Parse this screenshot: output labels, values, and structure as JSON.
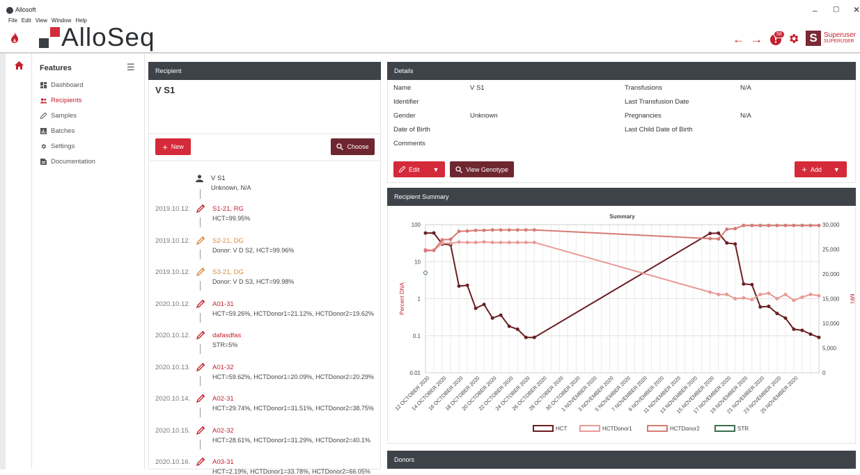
{
  "window": {
    "app_name": "Allosoft",
    "menu": [
      "File",
      "Edit",
      "View",
      "Window",
      "Help"
    ],
    "logo_text": "AlloSeq",
    "minimize": "–",
    "maximize": "▢",
    "close": "✕"
  },
  "header": {
    "back": "←",
    "forward": "→",
    "notification_count": "58",
    "user_initial": "S",
    "user_name": "Superuser",
    "user_role": "SUPERUSER"
  },
  "sidebar": {
    "title": "Features",
    "items": [
      {
        "label": "Dashboard"
      },
      {
        "label": "Recipients"
      },
      {
        "label": "Samples"
      },
      {
        "label": "Batches"
      },
      {
        "label": "Settings"
      },
      {
        "label": "Documentation"
      }
    ]
  },
  "recipient": {
    "header": "Recipient",
    "name": "V S1",
    "new_label": "New",
    "choose_label": "Choose",
    "timeline_head": {
      "name": "V S1",
      "sub": "Unknown, N/A"
    },
    "timeline": [
      {
        "date": "2019.10.12.",
        "title": "S1-21, RG",
        "sub": "HCT=99.95%",
        "color": "#c4202f"
      },
      {
        "date": "2019.10.12.",
        "title": "S2-21, DG",
        "sub": "Donor: V D S2, HCT=99.96%",
        "color": "#d98a3a"
      },
      {
        "date": "2019.10.12.",
        "title": "S3-21, DG",
        "sub": "Donor: V D S3, HCT=99.98%",
        "color": "#d98a3a"
      },
      {
        "date": "2020.10.12.",
        "title": "A01-31",
        "sub": "HCT=59.26%, HCTDonor1=21.12%, HCTDonor2=19.62%",
        "color": "#c4202f"
      },
      {
        "date": "2020.10.12.",
        "title": "dafasdfas",
        "sub": "STR=5%",
        "color": "#c4202f"
      },
      {
        "date": "2020.10.13.",
        "title": "A01-32",
        "sub": "HCT=59.62%, HCTDonor1=20.09%, HCTDonor2=20.29%",
        "color": "#c4202f"
      },
      {
        "date": "2020.10.14.",
        "title": "A02-31",
        "sub": "HCT=29.74%, HCTDonor1=31.51%, HCTDonor2=38.75%",
        "color": "#c4202f"
      },
      {
        "date": "2020.10.15.",
        "title": "A02-32",
        "sub": "HCT=28.61%, HCTDonor1=31.29%, HCTDonor2=40.1%",
        "color": "#c4202f"
      },
      {
        "date": "2020.10.16.",
        "title": "A03-31",
        "sub": "HCT=2.19%, HCTDonor1=33.78%, HCTDonor2=66.05%",
        "color": "#c4202f"
      }
    ]
  },
  "details": {
    "header": "Details",
    "name_label": "Name",
    "name_value": "V S1",
    "identifier_label": "Identifier",
    "gender_label": "Gender",
    "gender_value": "Unknown",
    "dob_label": "Date of Birth",
    "comments_label": "Comments",
    "transfusions_label": "Transfusions",
    "transfusions_value": "N/A",
    "last_transfusion_label": "Last Transfusion Date",
    "pregnancies_label": "Pregnancies",
    "pregnancies_value": "N/A",
    "last_child_label": "Last Child Date of Birth",
    "edit_label": "Edit",
    "view_genotype_label": "View Genotype",
    "add_label": "Add"
  },
  "summary": {
    "header": "Recipient Summary"
  },
  "donors": {
    "header": "Donors"
  },
  "chart_data": {
    "type": "line",
    "title": "Summary",
    "ylabel": "Percent DNA",
    "y2label": "MFI",
    "y_scale": "log",
    "ylim": [
      0.01,
      100
    ],
    "y2lim": [
      0,
      30000
    ],
    "y_ticks": [
      "100",
      "10",
      "1",
      "0.1",
      "0.01"
    ],
    "y2_ticks": [
      "30,000",
      "25,000",
      "20,000",
      "15,000",
      "10,000",
      "5,000",
      "0"
    ],
    "x_ticks": [
      "12 OCTOBER 2020",
      "14 OCTOBER 2020",
      "16 OCTOBER 2020",
      "18 OCTOBER 2020",
      "20 OCTOBER 2020",
      "22 OCTOBER 2020",
      "24 OCTOBER 2020",
      "26 OCTOBER 2020",
      "28 OCTOBER 2020",
      "30 OCTOBER 2020",
      "1 NOVEMBER 2020",
      "3 NOVEMBER 2020",
      "5 NOVEMBER 2020",
      "7 NOVEMBER 2020",
      "9 NOVEMBER 2020",
      "11 NOVEMBER 2020",
      "13 NOVEMBER 2020",
      "15 NOVEMBER 2020",
      "17 NOVEMBER 2020",
      "19 NOVEMBER 2020",
      "21 NOVEMBER 2020",
      "23 NOVEMBER 2020",
      "25 NOVEMBER 2020"
    ],
    "legend_position": "bottom",
    "series": [
      {
        "name": "HCT",
        "color": "#6b1f24",
        "points": [
          [
            0,
            59.26
          ],
          [
            1,
            59.62
          ],
          [
            2,
            29.74
          ],
          [
            3,
            28.61
          ],
          [
            4,
            2.19
          ],
          [
            5,
            2.3
          ],
          [
            6,
            0.55
          ],
          [
            7,
            0.7
          ],
          [
            8,
            0.3
          ],
          [
            9,
            0.36
          ],
          [
            10,
            0.18
          ],
          [
            11,
            0.15
          ],
          [
            12,
            0.09
          ],
          [
            13,
            0.09
          ],
          [
            34,
            58
          ],
          [
            35,
            59
          ],
          [
            36,
            32
          ],
          [
            37,
            30
          ],
          [
            38,
            2.5
          ],
          [
            39,
            2.4
          ],
          [
            40,
            0.6
          ],
          [
            41,
            0.62
          ],
          [
            42,
            0.4
          ],
          [
            43,
            0.3
          ],
          [
            44,
            0.15
          ],
          [
            45,
            0.14
          ],
          [
            46,
            0.11
          ],
          [
            47,
            0.09
          ]
        ]
      },
      {
        "name": "HCTDonor1",
        "color": "#e89a96",
        "points": [
          [
            0,
            21.12
          ],
          [
            1,
            20.09
          ],
          [
            2,
            31.51
          ],
          [
            3,
            31.29
          ],
          [
            4,
            33.78
          ],
          [
            5,
            33
          ],
          [
            6,
            33
          ],
          [
            7,
            34
          ],
          [
            8,
            33
          ],
          [
            9,
            33
          ],
          [
            10,
            33
          ],
          [
            11,
            33
          ],
          [
            12,
            33
          ],
          [
            13,
            33
          ],
          [
            34,
            1.5
          ],
          [
            35,
            1.3
          ],
          [
            36,
            1.3
          ],
          [
            37,
            1.0
          ],
          [
            38,
            1.05
          ],
          [
            39,
            0.95
          ],
          [
            40,
            1.3
          ],
          [
            41,
            1.4
          ],
          [
            42,
            1.0
          ],
          [
            43,
            1.3
          ],
          [
            44,
            0.9
          ],
          [
            45,
            1.1
          ],
          [
            46,
            1.3
          ],
          [
            47,
            1.2
          ]
        ]
      },
      {
        "name": "HCTDonor2",
        "color": "#d77a72",
        "points": [
          [
            0,
            19.62
          ],
          [
            1,
            20.29
          ],
          [
            2,
            38.75
          ],
          [
            3,
            40.1
          ],
          [
            4,
            66.05
          ],
          [
            5,
            67
          ],
          [
            6,
            70
          ],
          [
            7,
            70
          ],
          [
            8,
            72
          ],
          [
            9,
            72
          ],
          [
            10,
            72
          ],
          [
            11,
            72
          ],
          [
            12,
            72
          ],
          [
            13,
            72
          ],
          [
            34,
            42
          ],
          [
            35,
            41
          ],
          [
            36,
            75
          ],
          [
            37,
            78
          ],
          [
            38,
            95
          ],
          [
            39,
            95
          ],
          [
            40,
            95
          ],
          [
            41,
            95
          ],
          [
            42,
            95
          ],
          [
            43,
            95
          ],
          [
            44,
            95
          ],
          [
            45,
            95
          ],
          [
            46,
            95
          ],
          [
            47,
            95
          ]
        ]
      },
      {
        "name": "STR",
        "color": "#3a6e50",
        "points": [
          [
            0,
            5
          ]
        ]
      }
    ]
  }
}
